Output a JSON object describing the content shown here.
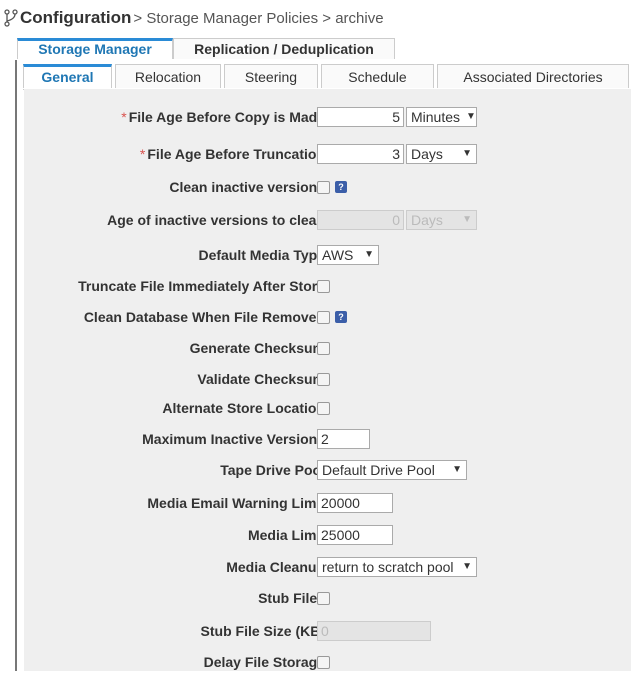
{
  "header": {
    "title": "Configuration",
    "breadcrumb": "> Storage Manager Policies > archive"
  },
  "outer_tabs": [
    {
      "label": "Storage Manager",
      "active": true
    },
    {
      "label": "Replication / Deduplication",
      "active": false
    }
  ],
  "inner_tabs": [
    {
      "label": "General",
      "active": true
    },
    {
      "label": "Relocation",
      "active": false
    },
    {
      "label": "Steering",
      "active": false
    },
    {
      "label": "Schedule",
      "active": false
    },
    {
      "label": "Associated Directories",
      "active": false
    }
  ],
  "fields": {
    "file_age_copy": {
      "label": "File Age Before Copy is Made",
      "required_mark": "*",
      "value": "5",
      "unit": "Minutes"
    },
    "file_age_trunc": {
      "label": "File Age Before Truncation",
      "required_mark": "*",
      "value": "3",
      "unit": "Days"
    },
    "clean_inactive": {
      "label": "Clean inactive versions",
      "help": "?"
    },
    "age_inactive": {
      "label": "Age of inactive versions to clean",
      "value": "0",
      "unit": "Days"
    },
    "media_type": {
      "label": "Default Media Type",
      "value": "AWS"
    },
    "truncate_immediately": {
      "label": "Truncate File Immediately After Store"
    },
    "clean_db": {
      "label": "Clean Database When File Removed",
      "help": "?"
    },
    "gen_checksum": {
      "label": "Generate Checksum"
    },
    "val_checksum": {
      "label": "Validate Checksum"
    },
    "alt_store": {
      "label": "Alternate Store Location"
    },
    "max_inactive": {
      "label": "Maximum Inactive Versions",
      "value": "2"
    },
    "tape_pool": {
      "label": "Tape Drive Pool",
      "value": "Default Drive Pool"
    },
    "email_warning": {
      "label": "Media Email Warning Limit",
      "value": "20000"
    },
    "media_limit": {
      "label": "Media Limit",
      "value": "25000"
    },
    "media_cleanup": {
      "label": "Media Cleanup",
      "value": "return to scratch pool"
    },
    "stub_files": {
      "label": "Stub Files"
    },
    "stub_size": {
      "label": "Stub File Size (KB)",
      "placeholder": "0"
    },
    "delay_storage": {
      "label": "Delay File Storage"
    }
  },
  "icons": {
    "header": "branch-icon",
    "help": "help-icon",
    "dropdown": "chevron-down-icon"
  },
  "colors": {
    "accent": "#2a8bd6",
    "help": "#3b5ea8",
    "required": "#d9534f",
    "form_bg": "#efefef"
  }
}
